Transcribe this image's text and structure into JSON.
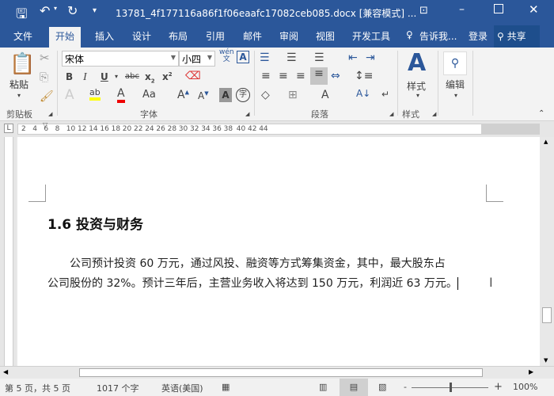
{
  "title": {
    "filename": "13781_4f177116a86f1f06eaafc17082ceb085.docx [兼容模式] ...",
    "save_icon": "save-icon",
    "undo_icon": "undo-icon",
    "redo_icon": "redo-icon"
  },
  "tabs": [
    "文件",
    "开始",
    "插入",
    "设计",
    "布局",
    "引用",
    "邮件",
    "审阅",
    "视图",
    "开发工具"
  ],
  "tell_me": "告诉我...",
  "login": "登录",
  "share": "共享",
  "ribbon": {
    "paste": "粘贴",
    "clipboard": "剪贴板",
    "font_name": "宋体",
    "font_size": "小四",
    "font_group": "字体",
    "paragraph_group": "段落",
    "styles": "样式",
    "styles_group": "样式",
    "edit": "编辑",
    "wen": "wén",
    "wen2": "文",
    "char_a": "A",
    "zi": "字"
  },
  "ruler": [
    "2",
    "4",
    "6",
    "8",
    "10",
    "12",
    "14",
    "16",
    "18",
    "20",
    "22",
    "24",
    "26",
    "28",
    "30",
    "32",
    "34",
    "36",
    "38",
    "40",
    "42",
    "44"
  ],
  "doc": {
    "heading": "1.6  投资与财务",
    "para_line1": "公司预计投资 60 万元，通过风投、融资等方式筹集资金，其中，最大股东占",
    "para_line2": "公司股份的 32%。预计三年后，主营业务收入将达到 150 万元，利润近 63 万元。"
  },
  "status": {
    "page": "第 5 页，共 5 页",
    "words": "1017 个字",
    "lang": "英语(美国)",
    "zoom": "100%",
    "zoom_percent": 100
  }
}
